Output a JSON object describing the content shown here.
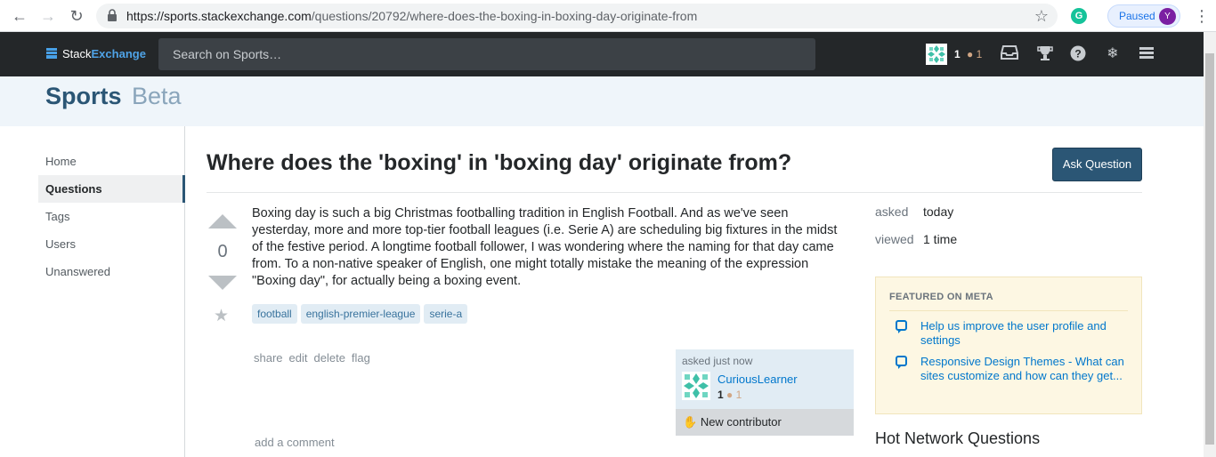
{
  "browser": {
    "url_host": "https://sports.stackexchange.com",
    "url_path": "/questions/20792/where-does-the-boxing-in-boxing-day-originate-from",
    "profile_status": "Paused",
    "profile_initial": "Y",
    "extension_letter": "G"
  },
  "topbar": {
    "logo_stack": "Stack",
    "logo_exchange": "Exchange",
    "search_placeholder": "Search on Sports…",
    "reputation": "1",
    "bronze_badges": "● 1"
  },
  "site": {
    "name": "Sports",
    "beta": "Beta"
  },
  "nav": {
    "items": [
      {
        "label": "Home"
      },
      {
        "label": "Questions"
      },
      {
        "label": "Tags"
      },
      {
        "label": "Users"
      },
      {
        "label": "Unanswered"
      }
    ],
    "active": "Questions"
  },
  "question": {
    "title": "Where does the 'boxing' in 'boxing day' originate from?",
    "ask_button": "Ask Question",
    "votes": "0",
    "body": "Boxing day is such a big Christmas footballing tradition in English Football. And as we've seen yesterday, more and more top-tier football leagues (i.e. Serie A) are scheduling big fixtures in the midst of the festive period. A longtime football follower, I was wondering where the naming for that day came from. To a non-native speaker of English, one might totally mistake the meaning of the expression \"Boxing day\", for actually being a boxing event.",
    "tags": [
      "football",
      "english-premier-league",
      "serie-a"
    ],
    "menu": [
      "share",
      "edit",
      "delete",
      "flag"
    ],
    "add_comment": "add a comment"
  },
  "owner": {
    "asked": "asked just now",
    "name": "CuriousLearner",
    "reputation": "1",
    "bronze": "● 1",
    "new_contributor": "New contributor"
  },
  "stats": {
    "asked_label": "asked",
    "asked_value": "today",
    "viewed_label": "viewed",
    "viewed_value": "1 time"
  },
  "featured": {
    "heading": "FEATURED ON META",
    "items": [
      {
        "text": "Help us improve the user profile and settings"
      },
      {
        "text": "Responsive Design Themes - What can sites customize and how can they get..."
      }
    ]
  },
  "hot": {
    "title": "Hot Network Questions"
  },
  "colors": {
    "topbar": "#242729",
    "accent": "#2b5675",
    "tag_bg": "#e1ecf4",
    "featured_bg": "#fdf7e3"
  }
}
